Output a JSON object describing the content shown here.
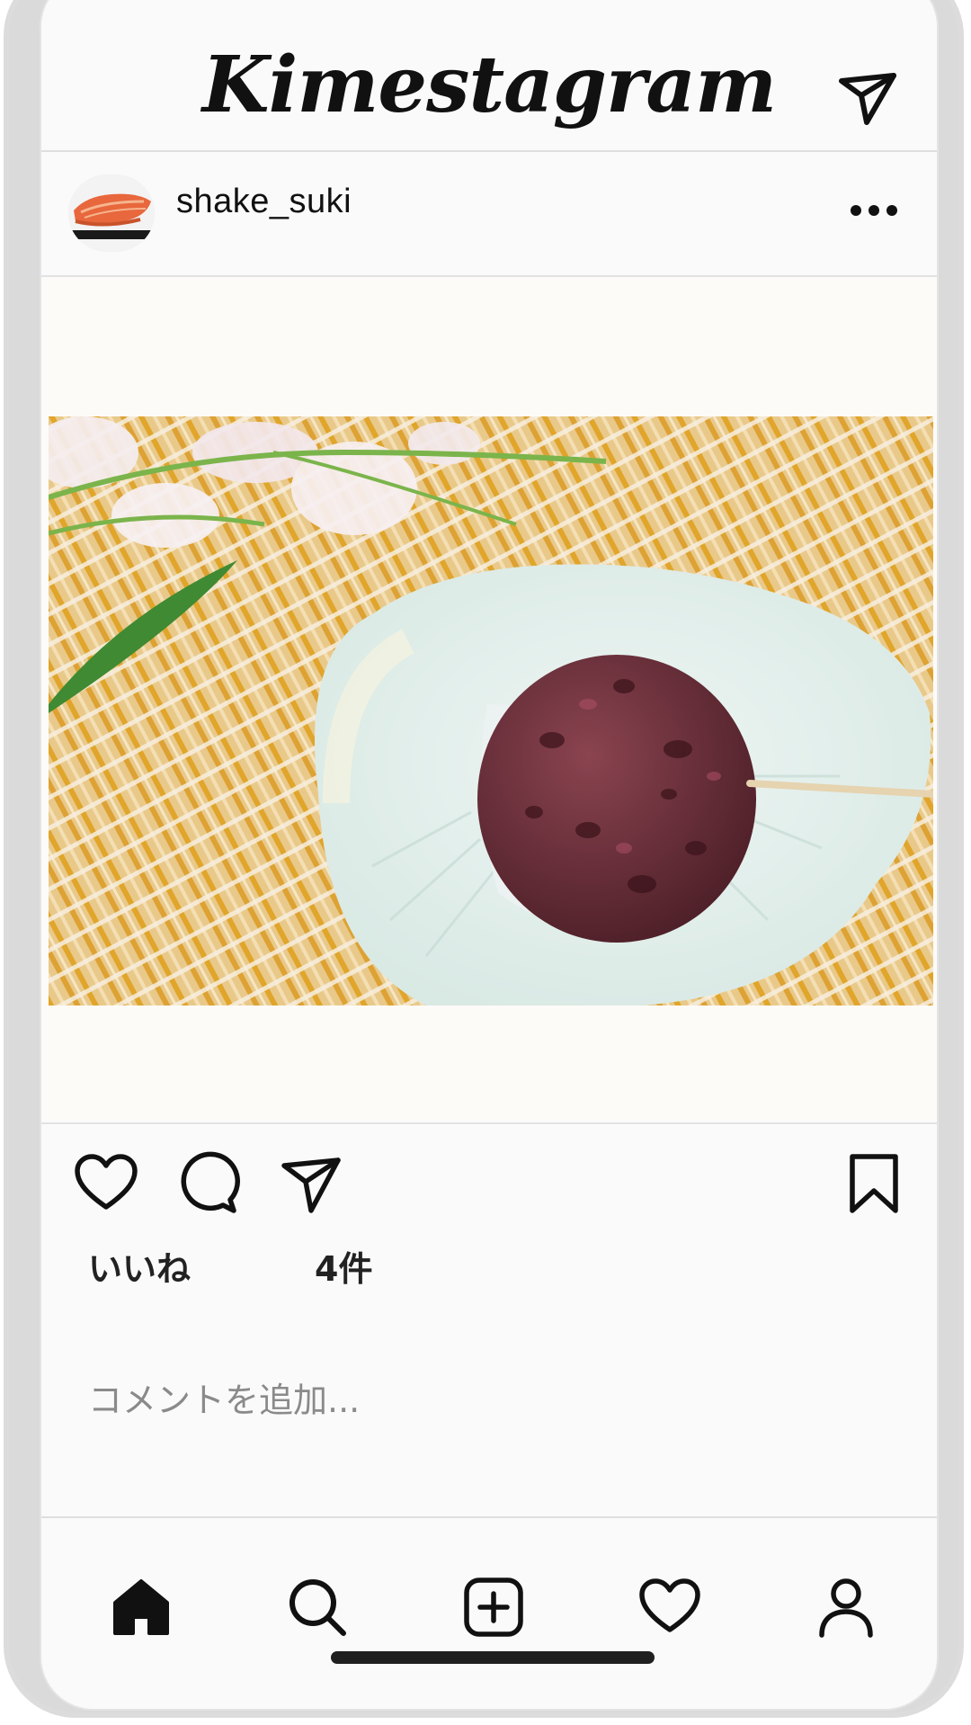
{
  "app": {
    "title": "Kimestagram"
  },
  "post": {
    "username": "shake_suki",
    "avatar_icon": "salmon-avatar",
    "image_alt": "ohagi-on-plate"
  },
  "actions": {
    "like_icon": "heart-icon",
    "comment_icon": "comment-icon",
    "share_icon": "send-icon",
    "save_icon": "bookmark-icon"
  },
  "likes": {
    "label": "いいね",
    "count": "4件"
  },
  "comment": {
    "placeholder": "コメントを追加..."
  },
  "nav": {
    "items": [
      "home-icon",
      "search-icon",
      "add-post-icon",
      "activity-heart-icon",
      "profile-icon"
    ]
  },
  "colors": {
    "background": "#fafafa",
    "text": "#111111",
    "divider": "#dedede",
    "placeholder": "#8a8a8a"
  }
}
